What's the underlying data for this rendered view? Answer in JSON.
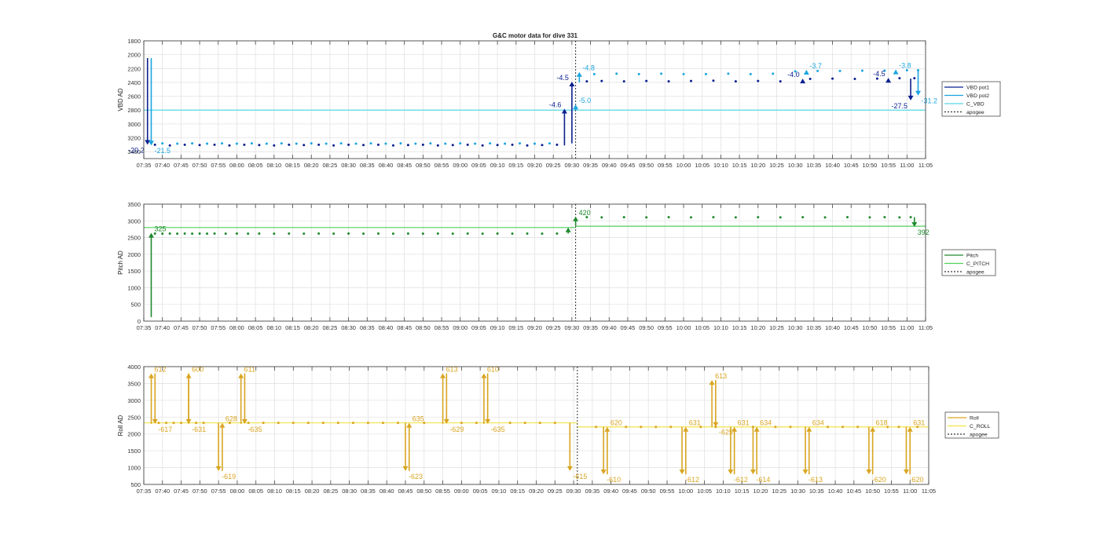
{
  "figure": {
    "title": "G&C motor data for dive 331"
  },
  "time_ticks": [
    "07:35",
    "07:40",
    "07:45",
    "07:50",
    "07:55",
    "08:00",
    "08:05",
    "08:10",
    "08:15",
    "08:20",
    "08:25",
    "08:30",
    "08:35",
    "08:40",
    "08:45",
    "08:50",
    "08:55",
    "09:00",
    "09:05",
    "09:10",
    "09:15",
    "09:20",
    "09:25",
    "09:30",
    "09:35",
    "09:40",
    "09:45",
    "09:50",
    "09:55",
    "10:00",
    "10:05",
    "10:10",
    "10:15",
    "10:20",
    "10:25",
    "10:30",
    "10:35",
    "10:40",
    "10:45",
    "10:50",
    "10:55",
    "11:00",
    "11:05"
  ],
  "colors": {
    "vbd1": "#0a1f8f",
    "vbd2": "#1aa5e0",
    "c_vbd": "#55d8e6",
    "pitch": "#1f8a2e",
    "c_pitch": "#4fd15a",
    "roll": "#d9a520",
    "c_roll": "#f2e24a",
    "apogee": "#333333",
    "grid": "#e3e3e3"
  },
  "chart_data": [
    {
      "type": "scatter",
      "ylabel": "VBD AD",
      "ylim": [
        1800,
        3500
      ],
      "y_reversed": true,
      "yticks": [
        1800,
        2000,
        2200,
        2400,
        2600,
        2800,
        3000,
        3200,
        3400
      ],
      "xlim": [
        "07:35",
        "11:05"
      ],
      "apogee": "09:31",
      "legend": [
        "VBD pot1",
        "VBD pot2",
        "C_VBD",
        "apogee"
      ],
      "legend_position": "right",
      "commanded": {
        "name": "C_VBD",
        "value": 2800
      },
      "series": [
        {
          "name": "VBD pot1",
          "x": [
            "07:38",
            "07:42",
            "07:46",
            "07:50",
            "07:54",
            "07:58",
            "08:02",
            "08:06",
            "08:10",
            "08:14",
            "08:18",
            "08:22",
            "08:26",
            "08:30",
            "08:34",
            "08:38",
            "08:42",
            "08:46",
            "08:50",
            "08:54",
            "08:58",
            "09:02",
            "09:06",
            "09:10",
            "09:14",
            "09:18",
            "09:22",
            "09:26",
            "09:34",
            "09:38",
            "09:44",
            "09:50",
            "09:56",
            "10:02",
            "10:08",
            "10:14",
            "10:20",
            "10:26",
            "10:34",
            "10:40",
            "10:46",
            "10:52",
            "10:58",
            "11:02"
          ],
          "values": [
            3300,
            3310,
            3300,
            3305,
            3300,
            3310,
            3300,
            3305,
            3310,
            3300,
            3305,
            3300,
            3310,
            3300,
            3305,
            3300,
            3310,
            3305,
            3300,
            3310,
            3305,
            3300,
            3310,
            3305,
            3300,
            3310,
            3305,
            3300,
            2385,
            2380,
            2385,
            2380,
            2385,
            2380,
            2375,
            2385,
            2380,
            2385,
            2350,
            2345,
            2350,
            2345,
            2340,
            2340
          ]
        },
        {
          "name": "VBD pot2",
          "x": [
            "07:40",
            "07:44",
            "07:48",
            "07:52",
            "07:56",
            "08:00",
            "08:04",
            "08:08",
            "08:12",
            "08:16",
            "08:20",
            "08:24",
            "08:28",
            "08:32",
            "08:36",
            "08:40",
            "08:44",
            "08:48",
            "08:52",
            "08:56",
            "09:00",
            "09:04",
            "09:08",
            "09:12",
            "09:16",
            "09:20",
            "09:24",
            "09:36",
            "09:42",
            "09:48",
            "09:54",
            "10:00",
            "10:06",
            "10:12",
            "10:18",
            "10:24",
            "10:30",
            "10:36",
            "10:42",
            "10:48",
            "10:54",
            "11:00",
            "11:03"
          ],
          "values": [
            3280,
            3285,
            3280,
            3285,
            3280,
            3285,
            3280,
            3285,
            3280,
            3285,
            3280,
            3285,
            3280,
            3285,
            3280,
            3285,
            3280,
            3285,
            3280,
            3285,
            3280,
            3285,
            3280,
            3285,
            3280,
            3285,
            3280,
            2280,
            2275,
            2280,
            2275,
            2280,
            2280,
            2275,
            2280,
            2275,
            2240,
            2235,
            2235,
            2230,
            2230,
            2225,
            2225
          ]
        }
      ],
      "events": [
        {
          "series": "VBD pot1",
          "x": "07:36",
          "from": 2050,
          "to": 3300,
          "label": "-20.2",
          "label_side": "left"
        },
        {
          "series": "VBD pot2",
          "x": "07:37",
          "from": 2050,
          "to": 3310,
          "label": "-21.5",
          "label_side": "right"
        },
        {
          "series": "VBD pot1",
          "x": "09:28",
          "from": 3310,
          "to": 2780,
          "label": "-4.6",
          "label_side": "left"
        },
        {
          "series": "VBD pot1",
          "x": "09:30",
          "from": 3280,
          "to": 2390,
          "label": "-4.5",
          "label_side": "left"
        },
        {
          "series": "VBD pot2",
          "x": "09:31",
          "from": 2800,
          "to": 2720,
          "label": "-5.0",
          "label_side": "right"
        },
        {
          "series": "VBD pot2",
          "x": "09:32",
          "from": 2400,
          "to": 2250,
          "label": "-4.8",
          "label_side": "right"
        },
        {
          "series": "VBD pot1",
          "x": "10:32",
          "from": 2365,
          "to": 2345,
          "label": "-4.0",
          "label_side": "left"
        },
        {
          "series": "VBD pot2",
          "x": "10:33",
          "from": 2230,
          "to": 2220,
          "label": "-3.7",
          "label_side": "right"
        },
        {
          "series": "VBD pot1",
          "x": "10:55",
          "from": 2345,
          "to": 2335,
          "label": "-4.5",
          "label_side": "left"
        },
        {
          "series": "VBD pot2",
          "x": "10:57",
          "from": 2225,
          "to": 2215,
          "label": "-3.8",
          "label_side": "right"
        },
        {
          "series": "VBD pot1",
          "x": "11:01",
          "from": 2345,
          "to": 2660,
          "label": "-27.5",
          "label_side": "left"
        },
        {
          "series": "VBD pot2",
          "x": "11:03",
          "from": 2225,
          "to": 2590,
          "label": "-31.2",
          "label_side": "right"
        }
      ]
    },
    {
      "type": "scatter",
      "ylabel": "Pitch AD",
      "ylim": [
        0,
        3500
      ],
      "yticks": [
        0,
        500,
        1000,
        1500,
        2000,
        2500,
        3000,
        3500
      ],
      "xlim": [
        "07:35",
        "11:05"
      ],
      "apogee": "09:31",
      "legend": [
        "Pitch",
        "C_PITCH",
        "apogee"
      ],
      "legend_position": "right",
      "commanded": [
        {
          "from": "07:35",
          "to": "09:31",
          "value": 2800
        },
        {
          "from": "09:31",
          "to": "11:05",
          "value": 2840
        }
      ],
      "series": [
        {
          "name": "Pitch",
          "x": [
            "07:38",
            "07:40",
            "07:42",
            "07:44",
            "07:46",
            "07:48",
            "07:50",
            "07:52",
            "07:54",
            "07:57",
            "08:00",
            "08:03",
            "08:06",
            "08:10",
            "08:14",
            "08:18",
            "08:22",
            "08:26",
            "08:30",
            "08:34",
            "08:38",
            "08:42",
            "08:46",
            "08:50",
            "08:54",
            "08:58",
            "09:02",
            "09:06",
            "09:10",
            "09:14",
            "09:18",
            "09:22",
            "09:26",
            "09:34",
            "09:38",
            "09:44",
            "09:50",
            "09:56",
            "10:02",
            "10:08",
            "10:14",
            "10:20",
            "10:26",
            "10:32",
            "10:38",
            "10:44",
            "10:50",
            "10:54",
            "10:58",
            "11:01"
          ],
          "values": [
            2620,
            2615,
            2620,
            2615,
            2620,
            2615,
            2620,
            2615,
            2620,
            2615,
            2620,
            2615,
            2620,
            2615,
            2620,
            2615,
            2620,
            2615,
            2620,
            2615,
            2620,
            2615,
            2620,
            2615,
            2620,
            2615,
            2620,
            2615,
            2620,
            2615,
            2620,
            2615,
            2620,
            3110,
            3105,
            3110,
            3105,
            3110,
            3105,
            3110,
            3105,
            3110,
            3105,
            3110,
            3105,
            3110,
            3105,
            3110,
            3105,
            3110
          ]
        }
      ],
      "events": [
        {
          "series": "Pitch",
          "x": "07:37",
          "from": 120,
          "to": 2640,
          "label": "325",
          "label_side": "right"
        },
        {
          "series": "Pitch",
          "x": "09:29",
          "from": 2620,
          "to": 2800,
          "label": "",
          "label_side": "right"
        },
        {
          "series": "Pitch",
          "x": "09:31",
          "from": 2850,
          "to": 3130,
          "label": "420",
          "label_side": "right"
        },
        {
          "series": "Pitch",
          "x": "11:02",
          "from": 3110,
          "to": 2820,
          "label": "392",
          "label_side": "right"
        }
      ]
    },
    {
      "type": "scatter",
      "ylabel": "Roll AD",
      "ylim": [
        500,
        4000
      ],
      "yticks": [
        500,
        1000,
        1500,
        2000,
        2500,
        3000,
        3500,
        4000
      ],
      "xlim": [
        "07:35",
        "11:05"
      ],
      "apogee": "09:31",
      "legend": [
        "Roll",
        "C_ROLL",
        "apogee"
      ],
      "legend_position": "right",
      "commanded": [
        {
          "from": "07:35",
          "to": "09:31",
          "value": 2330
        },
        {
          "from": "09:31",
          "to": "11:05",
          "value": 2210
        }
      ],
      "series": [
        {
          "name": "Roll",
          "x": [
            "07:39",
            "07:41",
            "07:43",
            "07:45",
            "07:49",
            "07:51",
            "07:58",
            "08:03",
            "08:07",
            "08:11",
            "08:15",
            "08:19",
            "08:23",
            "08:27",
            "08:31",
            "08:35",
            "08:39",
            "08:43",
            "08:50",
            "09:00",
            "09:04",
            "09:13",
            "09:17",
            "09:21",
            "09:25",
            "09:36",
            "09:44",
            "09:48",
            "09:52",
            "09:56",
            "10:04",
            "10:08",
            "10:18",
            "10:24",
            "10:28",
            "10:38",
            "10:42",
            "10:46",
            "10:54",
            "10:57",
            "11:02"
          ],
          "values": [
            2330,
            2330,
            2330,
            2330,
            2330,
            2330,
            2330,
            2330,
            2330,
            2330,
            2330,
            2330,
            2330,
            2330,
            2330,
            2330,
            2330,
            2330,
            2330,
            2330,
            2330,
            2330,
            2330,
            2330,
            2330,
            2210,
            2210,
            2210,
            2210,
            2210,
            2210,
            2210,
            2210,
            2210,
            2210,
            2210,
            2210,
            2210,
            2210,
            2210,
            2210
          ]
        }
      ],
      "events": [
        {
          "series": "Roll",
          "x": "07:37",
          "from": 2300,
          "to": 3800,
          "label": "612",
          "label_side": "right"
        },
        {
          "series": "Roll",
          "x": "07:38",
          "from": 3800,
          "to": 2300,
          "label": "-617",
          "label_side": "right"
        },
        {
          "series": "Roll",
          "x": "07:47",
          "from": 2300,
          "to": 3800,
          "label": "600",
          "label_side": "right"
        },
        {
          "series": "Roll",
          "x": "07:47",
          "from": 3800,
          "to": 2300,
          "label": "-631",
          "label_side": "right"
        },
        {
          "series": "Roll",
          "x": "07:55",
          "from": 2330,
          "to": 900,
          "label": "-619",
          "label_side": "right"
        },
        {
          "series": "Roll",
          "x": "07:56",
          "from": 900,
          "to": 2330,
          "label": "628",
          "label_side": "right"
        },
        {
          "series": "Roll",
          "x": "08:01",
          "from": 2300,
          "to": 3800,
          "label": "611",
          "label_side": "right"
        },
        {
          "series": "Roll",
          "x": "08:02",
          "from": 3800,
          "to": 2300,
          "label": "-635",
          "label_side": "right"
        },
        {
          "series": "Roll",
          "x": "08:45",
          "from": 2330,
          "to": 900,
          "label": "-623",
          "label_side": "right"
        },
        {
          "series": "Roll",
          "x": "08:46",
          "from": 900,
          "to": 2330,
          "label": "635",
          "label_side": "right"
        },
        {
          "series": "Roll",
          "x": "08:55",
          "from": 2300,
          "to": 3800,
          "label": "613",
          "label_side": "right"
        },
        {
          "series": "Roll",
          "x": "08:56",
          "from": 3800,
          "to": 2300,
          "label": "-629",
          "label_side": "right"
        },
        {
          "series": "Roll",
          "x": "09:06",
          "from": 2300,
          "to": 3800,
          "label": "610",
          "label_side": "right"
        },
        {
          "series": "Roll",
          "x": "09:07",
          "from": 3800,
          "to": 2300,
          "label": "-635",
          "label_side": "right"
        },
        {
          "series": "Roll",
          "x": "09:29",
          "from": 2330,
          "to": 900,
          "label": "-615",
          "label_side": "right"
        },
        {
          "series": "Roll",
          "x": "09:38",
          "from": 2210,
          "to": 800,
          "label": "-610",
          "label_side": "right"
        },
        {
          "series": "Roll",
          "x": "09:39",
          "from": 800,
          "to": 2210,
          "label": "620",
          "label_side": "right"
        },
        {
          "series": "Roll",
          "x": "09:59",
          "from": 2210,
          "to": 800,
          "label": "-612",
          "label_side": "right"
        },
        {
          "series": "Roll",
          "x": "10:00",
          "from": 800,
          "to": 2210,
          "label": "631",
          "label_side": "right"
        },
        {
          "series": "Roll",
          "x": "10:07",
          "from": 2210,
          "to": 3600,
          "label": "613",
          "label_side": "right"
        },
        {
          "series": "Roll",
          "x": "10:08",
          "from": 3600,
          "to": 2210,
          "label": "-625",
          "label_side": "right"
        },
        {
          "series": "Roll",
          "x": "10:12",
          "from": 2210,
          "to": 800,
          "label": "-612",
          "label_side": "right"
        },
        {
          "series": "Roll",
          "x": "10:13",
          "from": 800,
          "to": 2210,
          "label": "631",
          "label_side": "right"
        },
        {
          "series": "Roll",
          "x": "10:18",
          "from": 2210,
          "to": 800,
          "label": "-614",
          "label_side": "right"
        },
        {
          "series": "Roll",
          "x": "10:19",
          "from": 800,
          "to": 2210,
          "label": "634",
          "label_side": "right"
        },
        {
          "series": "Roll",
          "x": "10:32",
          "from": 2210,
          "to": 800,
          "label": "-613",
          "label_side": "right"
        },
        {
          "series": "Roll",
          "x": "10:33",
          "from": 800,
          "to": 2210,
          "label": "634",
          "label_side": "right"
        },
        {
          "series": "Roll",
          "x": "10:49",
          "from": 2210,
          "to": 800,
          "label": "-620",
          "label_side": "right"
        },
        {
          "series": "Roll",
          "x": "10:50",
          "from": 800,
          "to": 2210,
          "label": "618",
          "label_side": "right"
        },
        {
          "series": "Roll",
          "x": "10:59",
          "from": 2210,
          "to": 800,
          "label": "-620",
          "label_side": "right"
        },
        {
          "series": "Roll",
          "x": "11:00",
          "from": 800,
          "to": 2210,
          "label": "631",
          "label_side": "right"
        }
      ]
    }
  ]
}
